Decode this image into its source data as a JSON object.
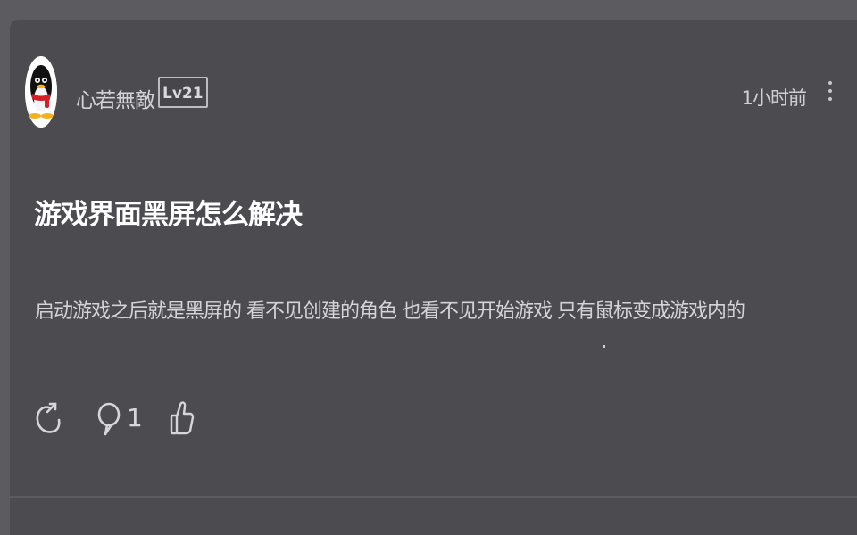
{
  "post": {
    "author": "心若無敵",
    "level": "Lv21",
    "time": "1小时前",
    "title": "游戏界面黑屏怎么解决",
    "content": "启动游戏之后就是黑屏的 看不见创建的角色 也看不见开始游戏 只有鼠标变成游戏内的",
    "comment_count": "1"
  },
  "icons": {
    "avatar": "qq-penguin-avatar",
    "more": "more-vertical-icon",
    "share": "share-icon",
    "comment": "comment-icon",
    "like": "thumbs-up-icon"
  },
  "colors": {
    "background": "#5c5b60",
    "card": "#4c4b50",
    "title": "#ffffff",
    "text": "#d4d4d7"
  }
}
